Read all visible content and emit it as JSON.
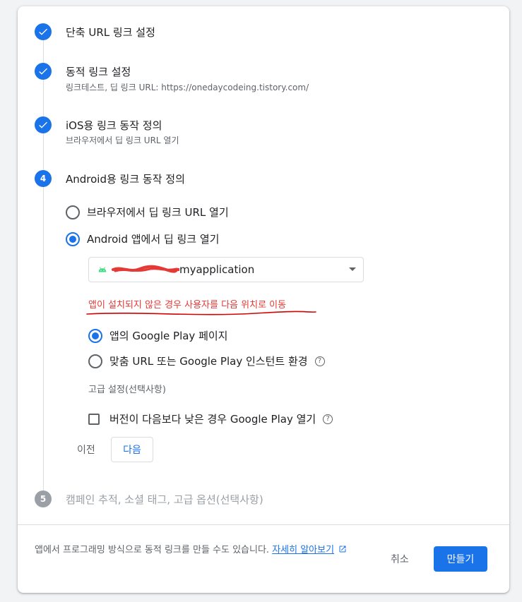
{
  "steps": [
    {
      "number": "1",
      "title": "단축 URL 링크 설정",
      "subtitle": ""
    },
    {
      "number": "2",
      "title": "동적 링크 설정",
      "subtitle": "링크테스트, 딥 링크 URL: https://onedaycodeing.tistory.com/"
    },
    {
      "number": "3",
      "title": "iOS용 링크 동작 정의",
      "subtitle": "브라우저에서 딥 링크 URL 열기"
    },
    {
      "number": "4",
      "title": "Android용 링크 동작 정의",
      "subtitle": ""
    },
    {
      "number": "5",
      "title": "캠페인 추적, 소셜 태그, 고급 옵션(선택사항)",
      "subtitle": ""
    }
  ],
  "android": {
    "option_browser": "브라우저에서 딥 링크 URL 열기",
    "option_app": "Android 앱에서 딥 링크 열기",
    "selected_option": "app",
    "app_select_value": "myapplication",
    "not_installed_note": "앱이 설치되지 않은 경우 사용자를 다음 위치로 이동",
    "option_play_page": "앱의 Google Play 페이지",
    "option_custom_url": "맞춤 URL 또는 Google Play 인스턴트 환경",
    "selected_fallback": "play_page",
    "advanced_label": "고급 설정(선택사항)",
    "checkbox_label": "버전이 다음보다 낮은 경우 Google Play 열기",
    "checkbox_checked": false
  },
  "nav": {
    "prev_label": "이전",
    "next_label": "다음"
  },
  "footer": {
    "text": "앱에서 프로그래밍 방식으로 동적 링크를 만들 수도 있습니다.",
    "link_label": "자세히 알아보기",
    "cancel_label": "취소",
    "create_label": "만들기"
  },
  "icons": {
    "completed": "check-icon",
    "help": "help-circle-icon",
    "external": "open-in-new-icon",
    "app": "android-icon"
  },
  "colors": {
    "accent": "#1a73e8",
    "annotation": "#e53935",
    "disabled": "#9aa0a6"
  }
}
